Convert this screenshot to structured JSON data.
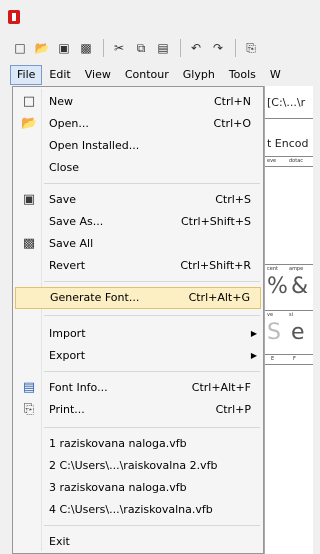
{
  "menubar": [
    "File",
    "Edit",
    "View",
    "Contour",
    "Glyph",
    "Tools",
    "W"
  ],
  "background": {
    "title": "[C:\\...\\r",
    "subtitle": "t Encod",
    "header_cells": [
      "eve",
      "dotac"
    ],
    "cells2": [
      "cent",
      "ampe"
    ],
    "cells3": [
      "ve",
      "si"
    ],
    "cells4": [
      "E",
      "F"
    ],
    "glyphs": [
      "%",
      "&",
      "S",
      "e"
    ]
  },
  "file_menu": {
    "new": {
      "label": "New",
      "shortcut": "Ctrl+N"
    },
    "open": {
      "label": "Open...",
      "shortcut": "Ctrl+O"
    },
    "open_installed": {
      "label": "Open Installed..."
    },
    "close": {
      "label": "Close"
    },
    "save": {
      "label": "Save",
      "shortcut": "Ctrl+S"
    },
    "save_as": {
      "label": "Save As...",
      "shortcut": "Ctrl+Shift+S"
    },
    "save_all": {
      "label": "Save All"
    },
    "revert": {
      "label": "Revert",
      "shortcut": "Ctrl+Shift+R"
    },
    "generate_font": {
      "label": "Generate Font...",
      "shortcut": "Ctrl+Alt+G"
    },
    "import": {
      "label": "Import"
    },
    "export": {
      "label": "Export"
    },
    "font_info": {
      "label": "Font Info...",
      "shortcut": "Ctrl+Alt+F"
    },
    "print": {
      "label": "Print...",
      "shortcut": "Ctrl+P"
    },
    "recent": [
      "1 raziskovana naloga.vfb",
      "2 C:\\Users\\...\\raiskovalna 2.vfb",
      "3 raziskovana naloga.vfb",
      "4 C:\\Users\\...\\raziskovalna.vfb"
    ],
    "exit": {
      "label": "Exit"
    }
  }
}
